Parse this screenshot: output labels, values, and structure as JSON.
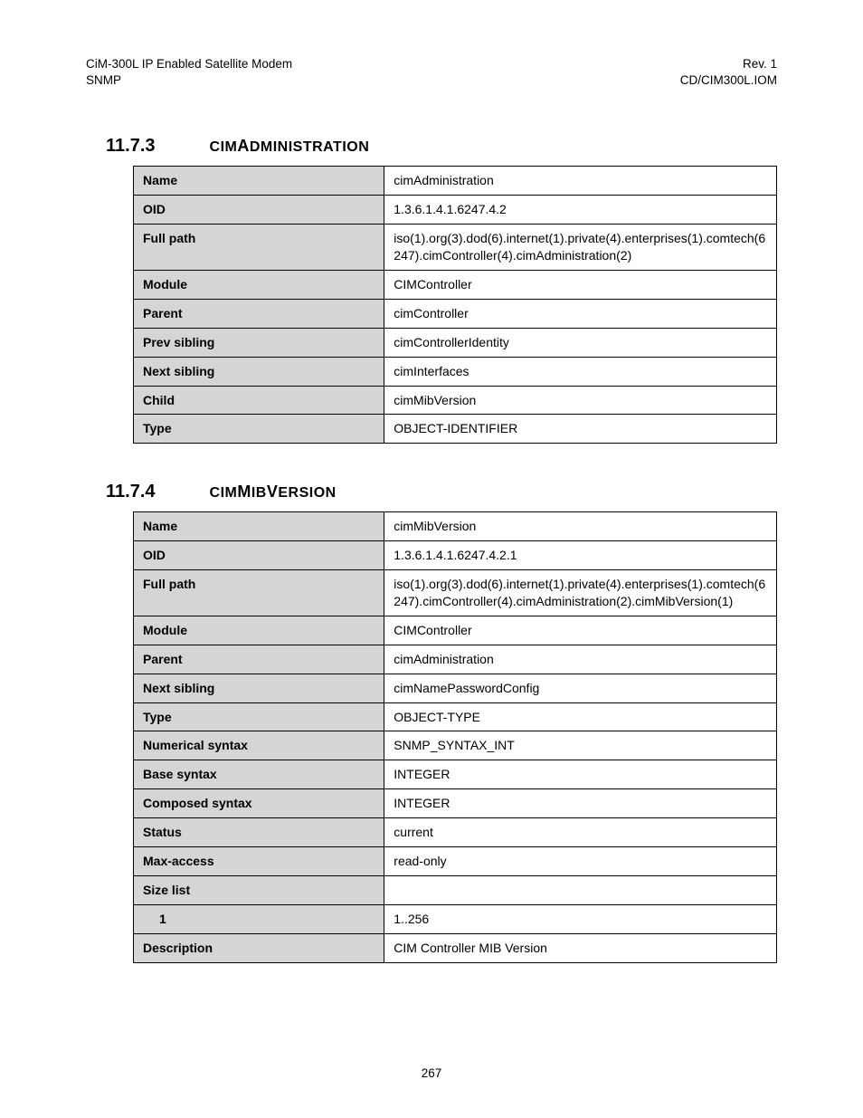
{
  "header": {
    "left1": "CiM-300L IP Enabled Satellite Modem",
    "left2": "SNMP",
    "right1": "Rev. 1",
    "right2": "CD/CIM300L.IOM"
  },
  "sections": [
    {
      "number": "11.7.3",
      "title_prefix": "CIM",
      "title_big": "A",
      "title_rest": "DMINISTRATION",
      "rows": [
        {
          "k": "Name",
          "v": "cimAdministration"
        },
        {
          "k": "OID",
          "v": "1.3.6.1.4.1.6247.4.2"
        },
        {
          "k": "Full path",
          "v": "iso(1).org(3).dod(6).internet(1).private(4).enterprises(1).comtech(6247).cimController(4).cimAdministration(2)"
        },
        {
          "k": "Module",
          "v": "CIMController"
        },
        {
          "k": "Parent",
          "v": "cimController"
        },
        {
          "k": "Prev sibling",
          "v": "cimControllerIdentity"
        },
        {
          "k": "Next sibling",
          "v": "cimInterfaces"
        },
        {
          "k": "Child",
          "v": "cimMibVersion"
        },
        {
          "k": "Type",
          "v": "OBJECT-IDENTIFIER"
        }
      ]
    },
    {
      "number": "11.7.4",
      "title_prefix": "CIM",
      "title_big": "M",
      "title_rest1": "IB",
      "title_big2": "V",
      "title_rest2": "ERSION",
      "rows": [
        {
          "k": "Name",
          "v": "cimMibVersion"
        },
        {
          "k": "OID",
          "v": "1.3.6.1.4.1.6247.4.2.1"
        },
        {
          "k": "Full path",
          "v": "iso(1).org(3).dod(6).internet(1).private(4).enterprises(1).comtech(6247).cimController(4).cimAdministration(2).cimMibVersion(1)"
        },
        {
          "k": "Module",
          "v": "CIMController"
        },
        {
          "k": "Parent",
          "v": "cimAdministration"
        },
        {
          "k": "Next sibling",
          "v": "cimNamePasswordConfig"
        },
        {
          "k": "Type",
          "v": "OBJECT-TYPE"
        },
        {
          "k": "Numerical syntax",
          "v": "SNMP_SYNTAX_INT"
        },
        {
          "k": "Base syntax",
          "v": "INTEGER"
        },
        {
          "k": "Composed syntax",
          "v": "INTEGER"
        },
        {
          "k": "Status",
          "v": "current"
        },
        {
          "k": "Max-access",
          "v": "read-only"
        },
        {
          "k": "Size list",
          "v": ""
        },
        {
          "k": "1",
          "v": "1..256",
          "indent": true
        },
        {
          "k": "Description",
          "v": "CIM Controller MIB Version"
        }
      ]
    }
  ],
  "page_number": "267"
}
